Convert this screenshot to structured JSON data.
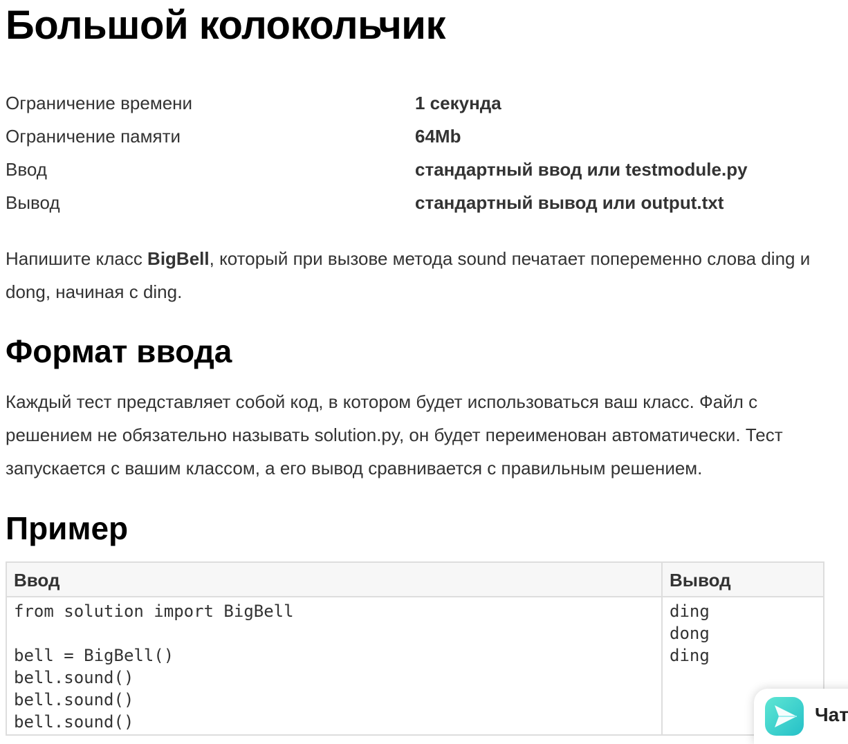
{
  "title": "Большой колокольчик",
  "limits": [
    {
      "label": "Ограничение времени",
      "value": "1 секунда"
    },
    {
      "label": "Ограничение памяти",
      "value": "64Mb"
    },
    {
      "label": "Ввод",
      "value": "стандартный ввод или testmodule.py"
    },
    {
      "label": "Вывод",
      "value": "стандартный вывод или output.txt"
    }
  ],
  "statement": {
    "before": "Напишите класс ",
    "bold": "BigBell",
    "after": ", который при вызове метода sound печатает попеременно слова ding и dong, начиная с ding."
  },
  "input_format": {
    "heading": "Формат ввода",
    "text": "Каждый тест представляет собой код, в котором будет использоваться ваш класс. Файл с решением не обязательно называть solution.py, он будет переименован автоматически. Тест запускается с вашим классом, а его вывод сравнивается с правильным решением."
  },
  "example": {
    "heading": "Пример",
    "input_header": "Ввод",
    "output_header": "Вывод",
    "input_lines": [
      "from solution import BigBell",
      "",
      "bell = BigBell()",
      "bell.sound()",
      "bell.sound()",
      "bell.sound()"
    ],
    "output_lines": [
      "ding",
      "dong",
      "ding"
    ]
  },
  "chat": {
    "label": "Чат",
    "icon": "send-arrow-icon",
    "accent": "#2ec4c6"
  }
}
